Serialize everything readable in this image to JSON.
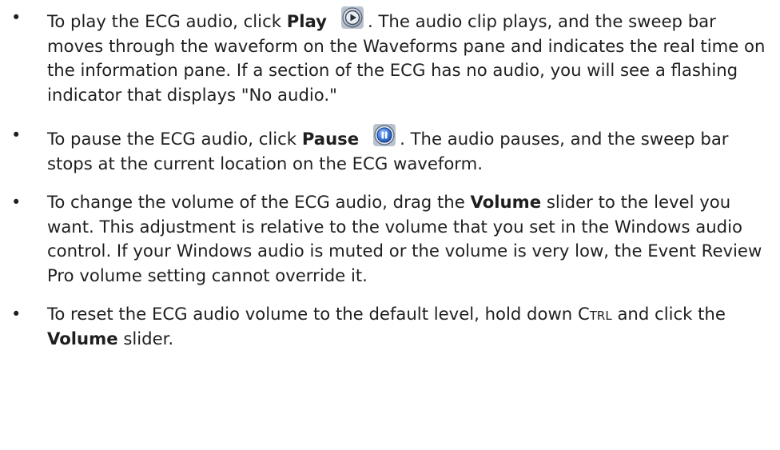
{
  "items": [
    {
      "part1": "To play the ECG audio, click ",
      "bold": "Play",
      "icon": "play-button-icon",
      "part2": ". The audio clip plays, and the sweep bar moves through the waveform on the Waveforms pane and indicates the real time on the information pane. If a section of the ECG has no audio, you will see a flashing indicator that displays \"No audio.\""
    },
    {
      "part1": "To pause the ECG audio, click ",
      "bold": "Pause",
      "icon": "pause-button-icon",
      "part2": ". The audio pauses, and the sweep bar stops at the current location on the ECG waveform."
    },
    {
      "part1": "To change the volume of the ECG audio, drag the ",
      "bold": "Volume",
      "part2": " slider to the level you want. This adjustment is relative to the volume that you set in the Windows audio control. If your Windows audio is muted or the volume is very low, the Event Review Pro volume setting cannot override it."
    },
    {
      "part1": "To reset the ECG audio volume to the default level, hold down ",
      "key": "Ctrl",
      "part1b": " and click the ",
      "bold": "Volume",
      "part2": " slider."
    }
  ],
  "bullet_char": "•",
  "colors": {
    "text": "#1f1f1f",
    "icon_ring": "#8a97a8",
    "icon_play_fill": "#cfd8e3",
    "icon_pause_fill": "#2f6fd6"
  }
}
